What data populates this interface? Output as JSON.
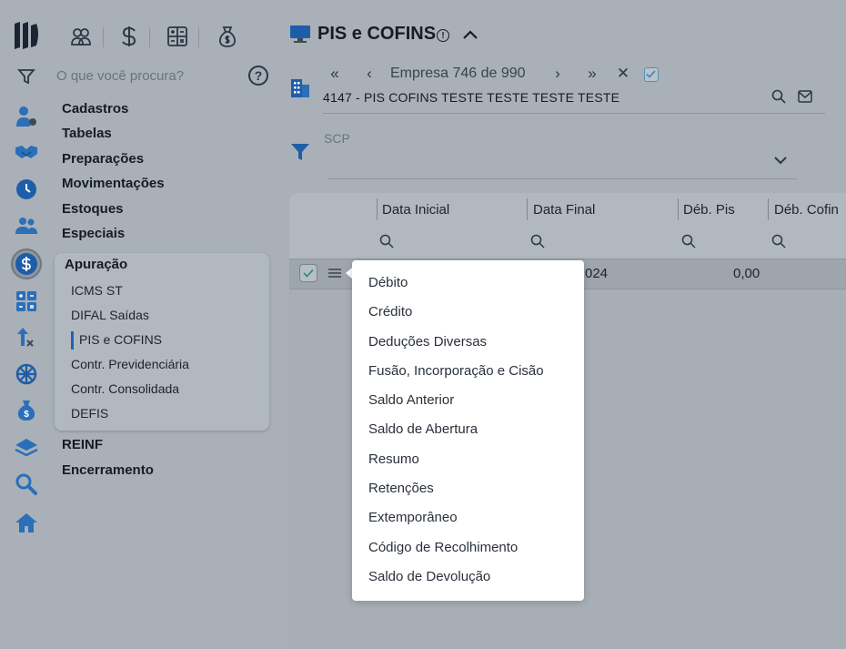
{
  "sidebar": {
    "search_placeholder": "O que você procura?",
    "menu": [
      "Cadastros",
      "Tabelas",
      "Preparações",
      "Movimentações",
      "Estoques",
      "Especiais"
    ],
    "apuracao": {
      "title": "Apuração",
      "items": [
        "ICMS ST",
        "DIFAL Saídas",
        "PIS e COFINS",
        "Contr. Previdenciária",
        "Contr. Consolidada",
        "DEFIS"
      ]
    },
    "menu_after": [
      "REINF",
      "Encerramento"
    ]
  },
  "header": {
    "title": "PIS e COFINS",
    "empresa_label": "Empresa 746 de 990",
    "company_name": "4147 - PIS COFINS TESTE TESTE TESTE TESTE",
    "scp_label": "SCP"
  },
  "table": {
    "columns": [
      "Data Inicial",
      "Data Final",
      "Déb. Pis",
      "Déb. Cofin"
    ],
    "row": {
      "data_final": "024",
      "deb_pis": "0,00"
    }
  },
  "dropdown": {
    "items": [
      "Débito",
      "Crédito",
      "Deduções Diversas",
      "Fusão, Incorporação e Cisão",
      "Saldo Anterior",
      "Saldo de Abertura",
      "Resumo",
      "Retenções",
      "Extemporâneo",
      "Código de Recolhimento",
      "Saldo de Devolução"
    ]
  },
  "colors": {
    "accent_blue": "#1e62c0",
    "icon_blue": "#2a6fb8",
    "background": "#a9b0b8"
  }
}
